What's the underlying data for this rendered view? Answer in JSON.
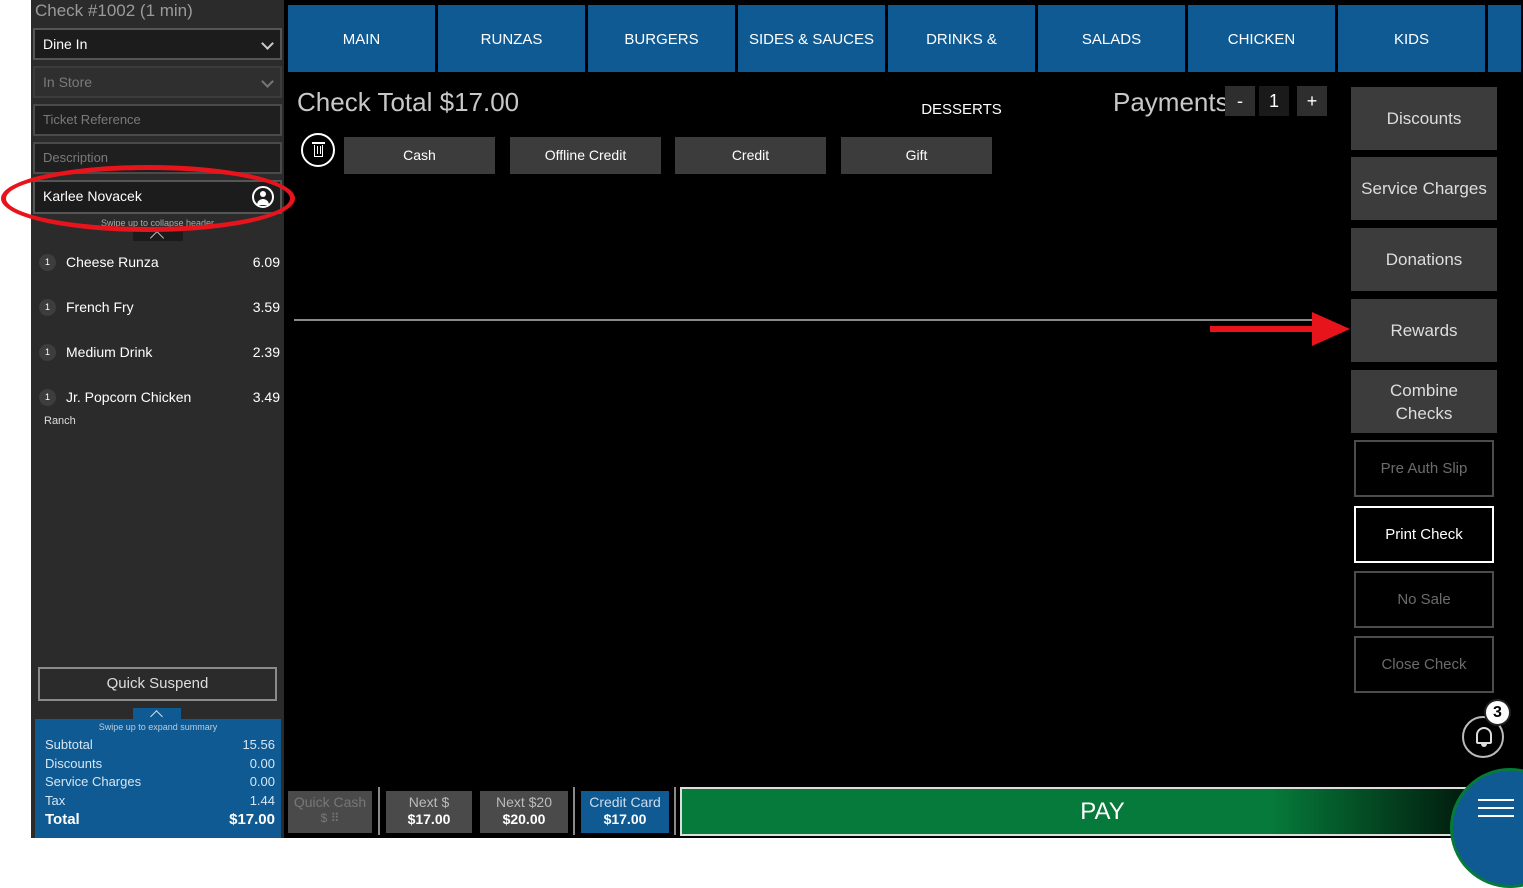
{
  "header": {
    "check_title": "Check #1002 (1 min)"
  },
  "order_fields": {
    "order_type": "Dine In",
    "location": "In Store",
    "ticket_reference_placeholder": "Ticket Reference",
    "description_placeholder": "Description",
    "customer_name": "Karlee Novacek",
    "collapse_hint": "Swipe up to collapse header"
  },
  "items": [
    {
      "qty": "1",
      "name": "Cheese Runza",
      "price": "6.09"
    },
    {
      "qty": "1",
      "name": "French Fry",
      "price": "3.59"
    },
    {
      "qty": "1",
      "name": "Medium Drink",
      "price": "2.39"
    },
    {
      "qty": "1",
      "name": "Jr. Popcorn Chicken",
      "price": "3.49",
      "modifier": "Ranch"
    }
  ],
  "quick_suspend": "Quick Suspend",
  "summary": {
    "expand_hint": "Swipe up to expand summary",
    "subtotal_label": "Subtotal",
    "subtotal": "15.56",
    "discounts_label": "Discounts",
    "discounts": "0.00",
    "service_label": "Service Charges",
    "service": "0.00",
    "tax_label": "Tax",
    "tax": "1.44",
    "total_label": "Total",
    "total": "$17.00"
  },
  "tabs": [
    "MAIN",
    "RUNZAS",
    "BURGERS",
    "SIDES & SAUCES",
    "DRINKS & DESSERTS",
    "SALADS",
    "CHICKEN",
    "KIDS"
  ],
  "payment": {
    "check_total_label": "Check Total",
    "check_total": "$17.00",
    "payments_label": "Payments",
    "minus": "-",
    "count": "1",
    "plus": "+",
    "types": [
      "Cash",
      "Offline Credit",
      "Credit",
      "Gift"
    ]
  },
  "actions": {
    "discounts": "Discounts",
    "service_charges": "Service Charges",
    "donations": "Donations",
    "rewards": "Rewards",
    "combine_checks": "Combine Checks",
    "pre_auth_slip": "Pre Auth Slip",
    "print_check": "Print Check",
    "no_sale": "No Sale",
    "close_check": "Close Check"
  },
  "notifications": {
    "count": "3"
  },
  "bottom": {
    "quick_cash": "Quick Cash",
    "quick_cash_sub": "$ ⠿",
    "next_dollar": "Next $",
    "next_dollar_amount": "$17.00",
    "next_20": "Next $20",
    "next_20_amount": "$20.00",
    "credit_card": "Credit Card",
    "credit_card_amount": "$17.00",
    "pay": "PAY"
  },
  "colors": {
    "accent_blue": "#0f5a92",
    "pay_green": "#067a3a",
    "annotation_red": "#e8141c"
  }
}
